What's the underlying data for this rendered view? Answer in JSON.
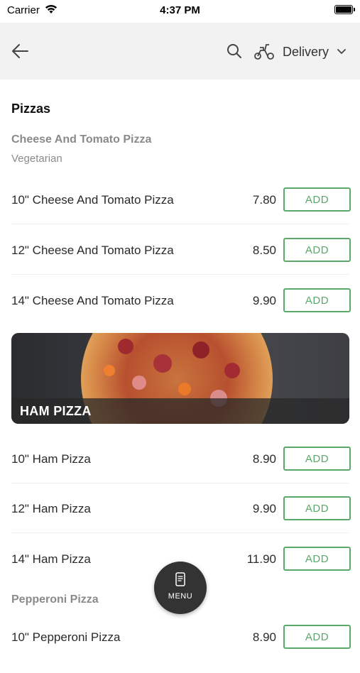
{
  "status_bar": {
    "carrier": "Carrier",
    "time": "4:37 PM"
  },
  "header": {
    "delivery_label": "Delivery"
  },
  "section": {
    "title": "Pizzas"
  },
  "groups": [
    {
      "title": "Cheese And Tomato Pizza",
      "subtitle": "Vegetarian",
      "items": [
        {
          "name": "10\" Cheese And Tomato Pizza",
          "price": "7.80",
          "button": "ADD"
        },
        {
          "name": "12\" Cheese And Tomato Pizza",
          "price": "8.50",
          "button": "ADD"
        },
        {
          "name": "14\" Cheese And Tomato Pizza",
          "price": "9.90",
          "button": "ADD"
        }
      ]
    },
    {
      "banner_label": "HAM PIZZA",
      "items": [
        {
          "name": "10\" Ham Pizza",
          "price": "8.90",
          "button": "ADD"
        },
        {
          "name": "12\" Ham Pizza",
          "price": "9.90",
          "button": "ADD"
        },
        {
          "name": "14\" Ham Pizza",
          "price": "11.90",
          "button": "ADD"
        }
      ]
    },
    {
      "title": "Pepperoni Pizza",
      "items": [
        {
          "name": "10\" Pepperoni Pizza",
          "price": "8.90",
          "button": "ADD"
        }
      ]
    }
  ],
  "fab": {
    "label": "MENU"
  },
  "colors": {
    "accent": "#5aa86a",
    "header_bg": "#f2f2f2",
    "fab_bg": "#333333"
  }
}
